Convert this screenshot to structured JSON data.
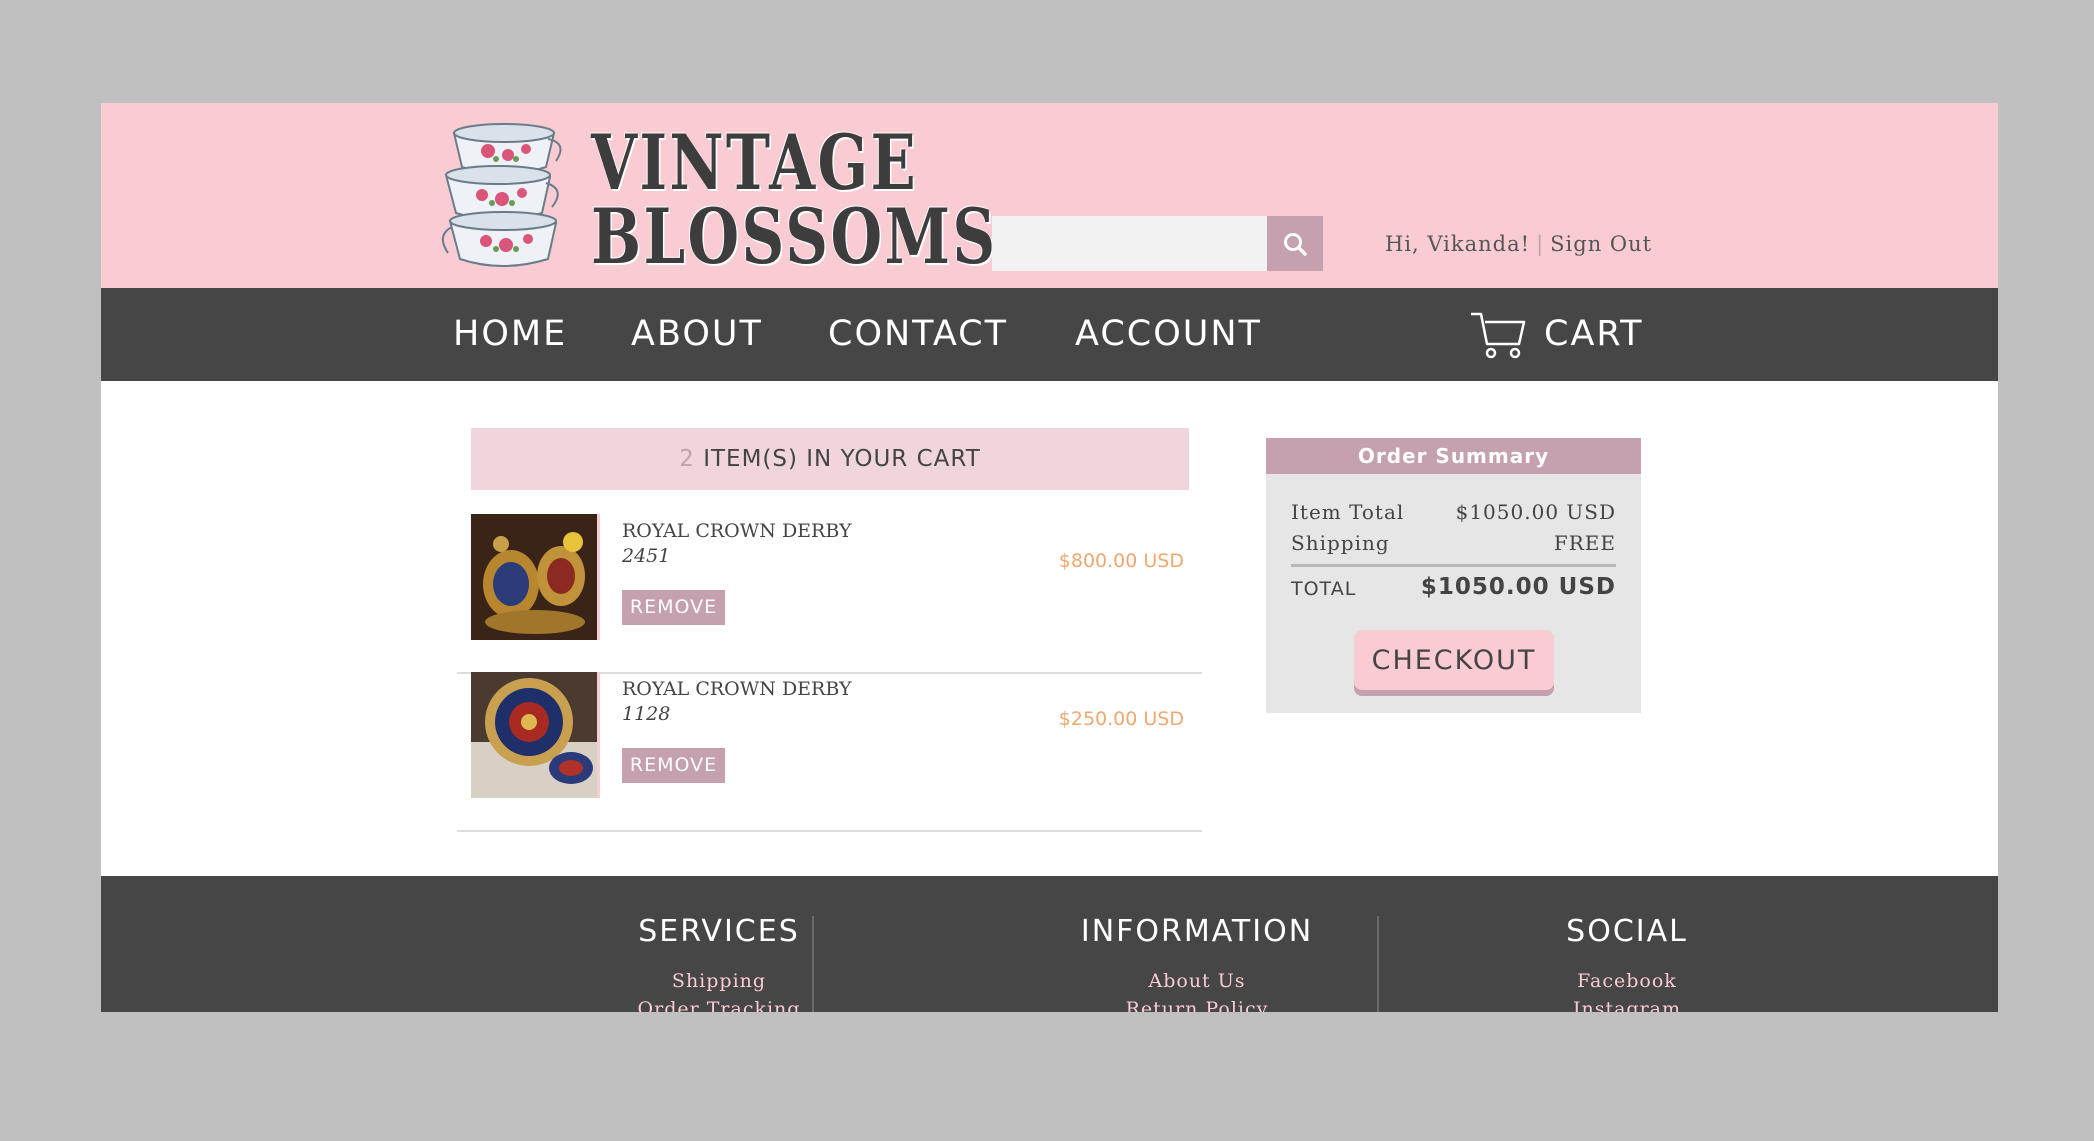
{
  "brand": {
    "line1": "VINTAGE",
    "line2": "BLOSSOMS"
  },
  "header": {
    "search": {
      "placeholder": "",
      "value": ""
    },
    "greeting": "Hi, Vikanda!",
    "separator": "|",
    "sign_out": "Sign Out"
  },
  "nav": {
    "items": [
      {
        "label": "HOME"
      },
      {
        "label": "ABOUT"
      },
      {
        "label": "CONTACT"
      },
      {
        "label": "ACCOUNT"
      }
    ],
    "cart_label": "CART"
  },
  "cart": {
    "count": "2",
    "header_suffix": "ITEM(S) IN YOUR CART",
    "remove_label": "REMOVE",
    "items": [
      {
        "name": "ROYAL CROWN DERBY",
        "number": "2451",
        "price": "$800.00 USD"
      },
      {
        "name": "ROYAL CROWN DERBY",
        "number": "1128",
        "price": "$250.00 USD"
      }
    ]
  },
  "summary": {
    "title": "Order Summary",
    "item_total_label": "Item Total",
    "item_total_value": "$1050.00 USD",
    "shipping_label": "Shipping",
    "shipping_value": "FREE",
    "total_label": "TOTAL",
    "total_value": "$1050.00 USD",
    "checkout_label": "CHECKOUT"
  },
  "footer": {
    "services": {
      "title": "SERVICES",
      "links": [
        "Shipping",
        "Order Tracking"
      ]
    },
    "information": {
      "title": "INFORMATION",
      "links": [
        "About Us",
        "Return Policy"
      ]
    },
    "social": {
      "title": "SOCIAL",
      "links": [
        "Facebook",
        "Instagram"
      ]
    }
  },
  "colors": {
    "header_pink": "#f9cbd3",
    "nav_dark": "#464646",
    "mauve": "#c5a0ae",
    "price_orange": "#f0a870"
  },
  "icons": [
    "teacup-stack-logo",
    "search-icon",
    "shopping-cart-icon"
  ]
}
